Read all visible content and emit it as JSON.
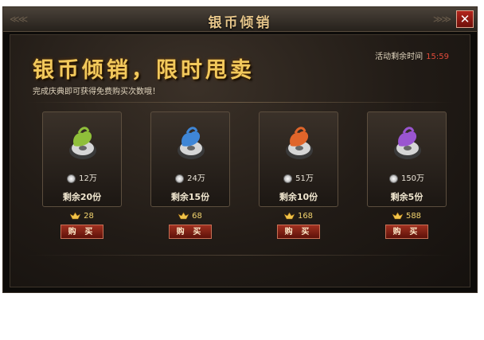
{
  "window": {
    "title": "银币倾销",
    "close_label": "✕"
  },
  "banner": {
    "headline": "银币倾销，限时甩卖",
    "subtitle": "完成庆典即可获得免费购买次数哦！",
    "timer_label": "活动剩余时间",
    "timer_value": "15:59"
  },
  "items": [
    {
      "color": "green",
      "silver": "12万",
      "remaining": "剩余20份",
      "price": "28",
      "buy_label": "购 买"
    },
    {
      "color": "blue",
      "silver": "24万",
      "remaining": "剩余15份",
      "price": "68",
      "buy_label": "购 买"
    },
    {
      "color": "orange",
      "silver": "51万",
      "remaining": "剩余10份",
      "price": "168",
      "buy_label": "购 买"
    },
    {
      "color": "purple",
      "silver": "150万",
      "remaining": "剩余5份",
      "price": "588",
      "buy_label": "购 买"
    }
  ],
  "colors": {
    "green": "#8fbf3a",
    "blue": "#3f86d6",
    "orange": "#e0652a",
    "purple": "#9a55d0",
    "headline": "#f2c95c",
    "timer": "#e04a3a"
  },
  "icons": [
    "silver-coin-icon",
    "gold-ingot-icon",
    "coin-pouch-icon",
    "close-icon"
  ]
}
